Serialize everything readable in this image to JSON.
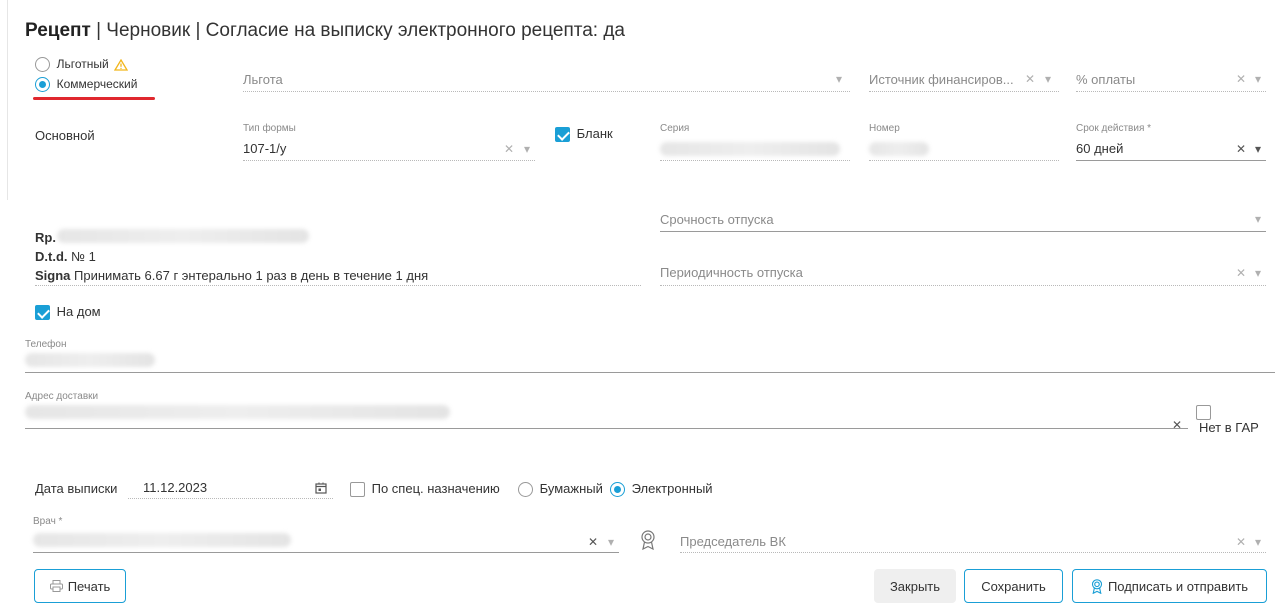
{
  "header": {
    "title_bold": "Рецепт",
    "title_rest": " | Черновик | Согласие на выписку электронного рецепта: да"
  },
  "type_options": {
    "privileged_label": "Льготный",
    "commercial_label": "Коммерческий",
    "selected": "Коммерческий"
  },
  "benefit": {
    "placeholder": "Льгота"
  },
  "funding": {
    "placeholder": "Источник финансиров..."
  },
  "payment": {
    "placeholder": "% оплаты"
  },
  "section_label": "Основной",
  "form_type": {
    "label": "Тип формы",
    "value": "107-1/у"
  },
  "blank": {
    "label": "Бланк",
    "checked": true
  },
  "series": {
    "label": "Серия"
  },
  "number": {
    "label": "Номер"
  },
  "validity": {
    "label": "Срок действия *",
    "value": "60 дней"
  },
  "urgency": {
    "placeholder": "Срочность отпуска"
  },
  "periodicity": {
    "placeholder": "Периодичность отпуска"
  },
  "prescription": {
    "rp_label": "Rp.",
    "dtd_label": "D.t.d.",
    "dtd_value": "№ 1",
    "signa_label": "Signa",
    "signa_value": "Принимать 6.67 г энтерально 1 раз в день в течение 1 дня"
  },
  "home_delivery": {
    "label": "На дом",
    "checked": true
  },
  "phone": {
    "label": "Телефон"
  },
  "address": {
    "label": "Адрес доставки",
    "no_gar_label": "Нет в ГАР"
  },
  "issue_date": {
    "label": "Дата выписки",
    "value": "11.12.2023"
  },
  "special_purpose": {
    "label": "По спец. назначению"
  },
  "format": {
    "paper_label": "Бумажный",
    "electronic_label": "Электронный",
    "selected": "Электронный"
  },
  "doctor": {
    "label": "Врач *"
  },
  "vk_chair": {
    "placeholder": "Председатель ВК"
  },
  "buttons": {
    "print": "Печать",
    "close": "Закрыть",
    "save": "Сохранить",
    "sign_send": "Подписать и отправить"
  },
  "colors": {
    "accent": "#1a9fd6",
    "highlight": "#e0282e",
    "warning": "#f2b61b"
  }
}
